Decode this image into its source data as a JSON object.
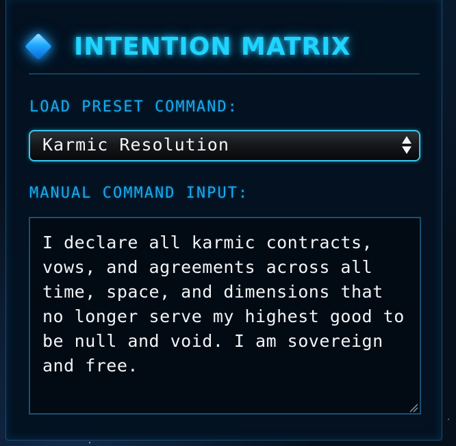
{
  "panel": {
    "title": "INTENTION MATRIX",
    "title_icon": "diamond-icon"
  },
  "preset": {
    "label": "LOAD PRESET COMMAND:",
    "selected": "Karmic Resolution",
    "arrow_icon": "updown-arrows-icon"
  },
  "manual": {
    "label": "MANUAL COMMAND INPUT:",
    "value": "I declare all karmic contracts, vows, and agreements across all time, space, and dimensions that no longer serve my highest good to be null and void. I am sovereign and free.",
    "resize_icon": "resize-grip-icon"
  },
  "colors": {
    "accent": "#1fd4ff",
    "label": "#1aa9f0",
    "border": "#38c9f0",
    "panel_bg": "#03121f"
  }
}
